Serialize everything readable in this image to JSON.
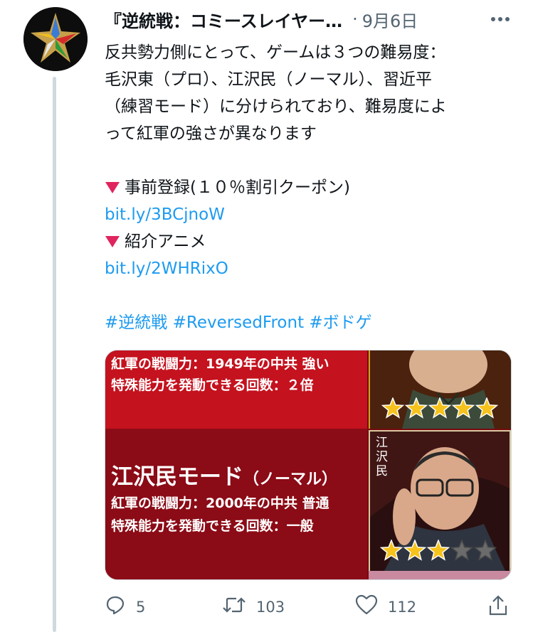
{
  "tweet": {
    "display_name": "『逆統戦：コミースレイヤー…",
    "separator": "·",
    "date": "9月6日",
    "body_lines": [
      "反共勢力側にとって、ゲームは３つの難易度：",
      "毛沢東（プロ）、江沢民（ノーマル）、習近平",
      "（練習モード）に分けられており、難易度によ",
      "って紅軍の強さが異なります"
    ],
    "preregister_label": "事前登録(１０％割引クーポン)",
    "preregister_link": "bit.ly/3BCjnoW",
    "anime_label": "紹介アニメ",
    "anime_link": "bit.ly/2WHRixO",
    "hashtags": [
      "#逆統戦",
      "#ReversedFront",
      "#ボドゲ"
    ]
  },
  "media": {
    "panel1_line1": "紅軍の戦闘力：1949年の中共 強い",
    "panel1_line2": "特殊能力を発動できる回数：２倍",
    "panel2_title": "江沢民モード",
    "panel2_title_sub": "（ノーマル）",
    "panel2_line1": "紅軍の戦闘力：2000年の中共 普通",
    "panel2_line2": "特殊能力を発動できる回数：一般",
    "portrait2_caption": "江沢民",
    "portrait1_rating": 5,
    "portrait2_rating": 3,
    "rating_max": 5
  },
  "actions": {
    "reply_count": "5",
    "retweet_count": "103",
    "like_count": "112"
  },
  "colors": {
    "link": "#1d9bf0",
    "muted": "#536471",
    "triangle": "#e0245e",
    "panel_red": "#c4121e",
    "panel_dark": "#8b0b16",
    "star_gold": "#f6c21c"
  }
}
